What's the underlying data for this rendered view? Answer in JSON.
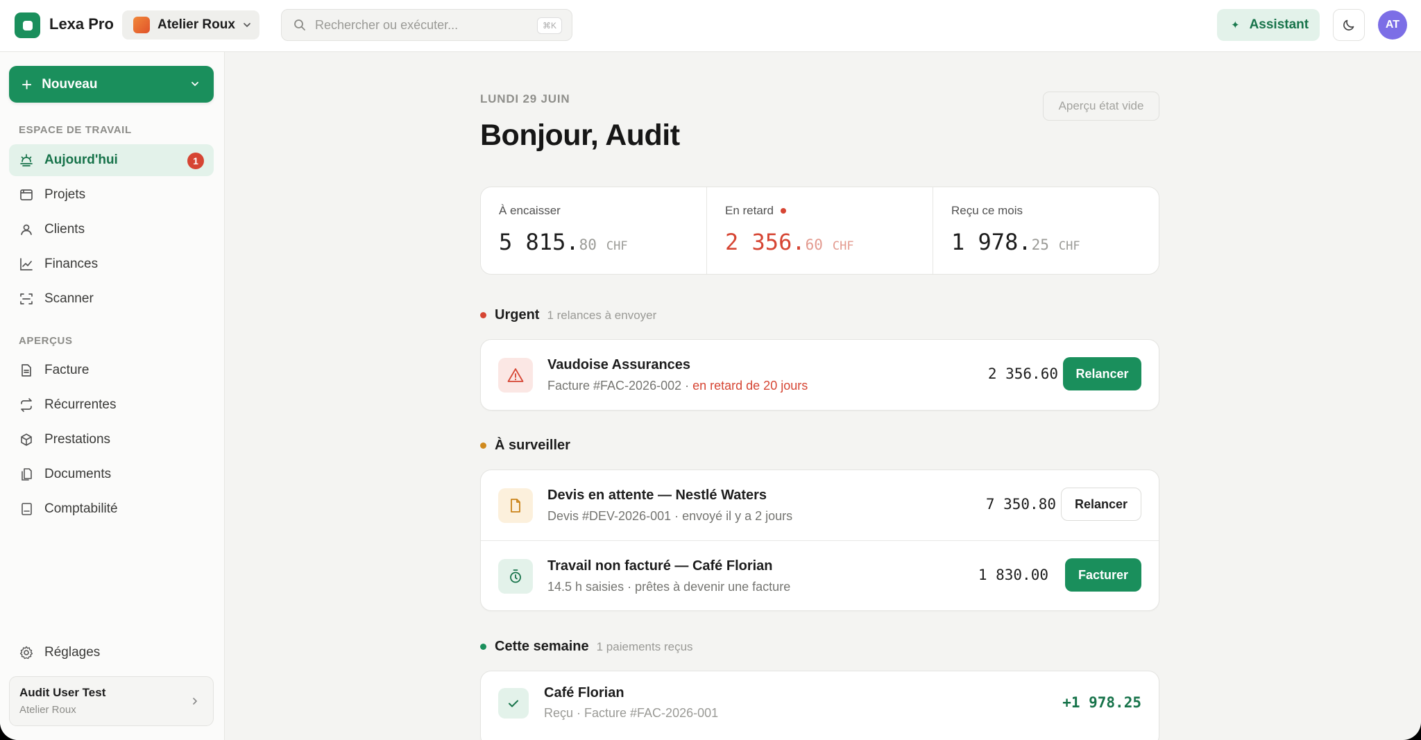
{
  "app": {
    "name": "Lexa Pro"
  },
  "workspace": {
    "name": "Atelier Roux"
  },
  "search": {
    "placeholder": "Rechercher ou exécuter...",
    "shortcut": "⌘K"
  },
  "header": {
    "assistant_label": "Assistant",
    "avatar_initials": "AT"
  },
  "sidebar": {
    "new_label": "Nouveau",
    "section_workspace": "ESPACE DE TRAVAIL",
    "workspace_items": [
      {
        "label": "Aujourd'hui",
        "icon": "sunrise-icon",
        "badge": "1",
        "active": true
      },
      {
        "label": "Projets",
        "icon": "folder-icon"
      },
      {
        "label": "Clients",
        "icon": "user-icon"
      },
      {
        "label": "Finances",
        "icon": "chart-line-icon"
      },
      {
        "label": "Scanner",
        "icon": "scan-icon"
      }
    ],
    "section_previews": "APERÇUS",
    "preview_items": [
      {
        "label": "Facture",
        "icon": "invoice-icon"
      },
      {
        "label": "Récurrentes",
        "icon": "repeat-icon"
      },
      {
        "label": "Prestations",
        "icon": "box-icon"
      },
      {
        "label": "Documents",
        "icon": "documents-icon"
      },
      {
        "label": "Comptabilité",
        "icon": "ledger-icon"
      }
    ],
    "settings_label": "Réglages",
    "user": {
      "name": "Audit User Test",
      "workspace": "Atelier Roux"
    }
  },
  "main": {
    "date": "LUNDI 29 JUIN",
    "greeting": "Bonjour, Audit",
    "empty_preview_label": "Aperçu état vide",
    "kpis": [
      {
        "label": "À encaisser",
        "int": "5 815.",
        "dec": "80",
        "currency": "CHF"
      },
      {
        "label": "En retard",
        "int": "2 356.",
        "dec": "60",
        "currency": "CHF",
        "alert": true
      },
      {
        "label": "Reçu ce mois",
        "int": "1 978.",
        "dec": "25",
        "currency": "CHF"
      }
    ],
    "urgent": {
      "title": "Urgent",
      "subtitle": "1 relances à envoyer",
      "color": "#d64533",
      "items": [
        {
          "title": "Vaudoise Assurances",
          "sub": "Facture #FAC-2026-002 · ",
          "sub_alert": "en retard de 20 jours",
          "amount": "2 356.60",
          "action": "Relancer"
        }
      ]
    },
    "watch": {
      "title": "À surveiller",
      "color": "#d08a1e",
      "items": [
        {
          "title": "Devis en attente — Nestlé Waters",
          "sub": "Devis #DEV-2026-001 · envoyé il y a 2 jours",
          "amount": "7 350.80",
          "action": "Relancer"
        },
        {
          "title": "Travail non facturé — Café Florian",
          "sub": "14.5 h saisies · prêtes à devenir une facture",
          "amount": "1 830.00",
          "action": "Facturer"
        }
      ]
    },
    "week": {
      "title": "Cette semaine",
      "subtitle": "1 paiements reçus",
      "color": "#1a8f5c",
      "items": [
        {
          "title": "Café Florian",
          "sub": "Reçu · Facture #FAC-2026-001",
          "amount": "+1 978.25"
        }
      ]
    }
  },
  "colors": {
    "accent": "#1a8f5c",
    "danger": "#d64533",
    "warning": "#d08a1e"
  }
}
